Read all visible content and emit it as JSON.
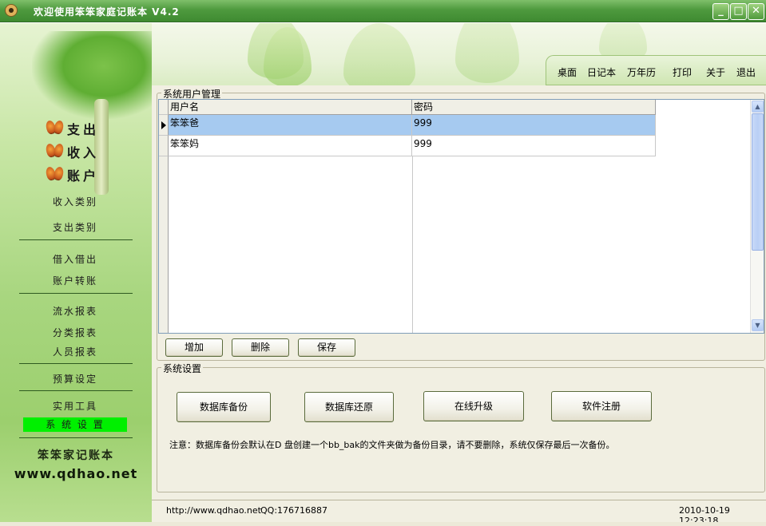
{
  "window": {
    "title": "欢迎使用笨笨家庭记账本 V4.2",
    "controls": {
      "minimize": "_",
      "maximize": "□",
      "close": "✕"
    }
  },
  "top_menu": [
    "桌面",
    "日记本",
    "万年历",
    "打印",
    "关于",
    "退出"
  ],
  "sidebar": {
    "main_nav": [
      "支出",
      "收入",
      "账户"
    ],
    "sub_items": [
      {
        "label": "收入类别",
        "active": false
      },
      {
        "label": "支出类别",
        "active": false
      },
      {
        "label": "借入借出",
        "active": false
      },
      {
        "label": "账户转账",
        "active": false
      },
      {
        "label": "流水报表",
        "active": false
      },
      {
        "label": "分类报表",
        "active": false
      },
      {
        "label": "人员报表",
        "active": false
      },
      {
        "label": "预算设定",
        "active": false
      },
      {
        "label": "实用工具",
        "active": false
      },
      {
        "label": "系 统 设 置",
        "active": true
      }
    ],
    "brand_name": "笨笨家记账本",
    "brand_url": "www.qdhao.net"
  },
  "user_group": {
    "title": "系统用户管理",
    "columns": [
      "用户名",
      "密码"
    ],
    "rows": [
      {
        "username": "笨笨爸",
        "password": "999",
        "selected": true
      },
      {
        "username": "笨笨妈",
        "password": "999",
        "selected": false
      }
    ],
    "buttons": {
      "add": "增加",
      "delete": "删除",
      "save": "保存"
    }
  },
  "system_group": {
    "title": "系统设置",
    "buttons": {
      "backup": "数据库备份",
      "restore": "数据库还原",
      "upgrade": "在线升级",
      "register": "软件注册"
    },
    "note": "注意：数据库备份会默认在D 盘创建一个bb_bak的文件夹做为备份目录，请不要删除，系统仅保存最后一次备份。"
  },
  "statusbar": {
    "url": "http://www.qdhao.net",
    "qq": "QQ:176716887",
    "datetime": "2010-10-19 12:23:18"
  },
  "colors": {
    "titlebar": "#4e9a3e",
    "selected_row": "#a6caf0",
    "active_sidebar_item": "#00f000",
    "panel_bg": "#f1efe2"
  }
}
